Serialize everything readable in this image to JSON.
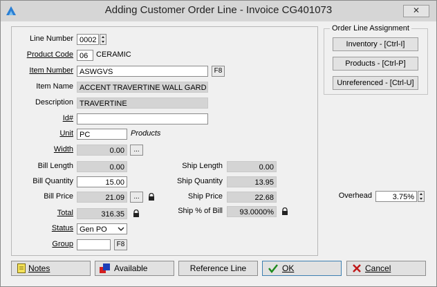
{
  "window": {
    "title": "Adding Customer Order Line - Invoice CG401073",
    "close_label": "✕"
  },
  "form": {
    "line_number": {
      "label": "Line Number",
      "value": "0002"
    },
    "product_code": {
      "label": "Product Code",
      "value": "06",
      "description": "CERAMIC"
    },
    "item_number": {
      "label": "Item Number",
      "value": "ASWGVS",
      "lookup": "F8"
    },
    "item_name": {
      "label": "Item Name",
      "value": "ACCENT TRAVERTINE WALL GARD"
    },
    "description": {
      "label": "Description",
      "value": "TRAVERTINE"
    },
    "id": {
      "label": "Id#",
      "value": ""
    },
    "unit": {
      "label": "Unit",
      "value": "PC",
      "note": "Products"
    },
    "width": {
      "label": "Width",
      "value": "0.00",
      "button": "..."
    },
    "bill_length": {
      "label": "Bill Length",
      "value": "0.00"
    },
    "bill_quantity": {
      "label": "Bill Quantity",
      "value": "15.00"
    },
    "bill_price": {
      "label": "Bill Price",
      "value": "21.09",
      "button": "..."
    },
    "total": {
      "label": "Total",
      "value": "316.35"
    },
    "status": {
      "label": "Status",
      "value": "Gen PO"
    },
    "group": {
      "label": "Group",
      "value": "",
      "lookup": "F8"
    },
    "ship_length": {
      "label": "Ship Length",
      "value": "0.00"
    },
    "ship_quantity": {
      "label": "Ship Quantity",
      "value": "13.95"
    },
    "ship_price": {
      "label": "Ship Price",
      "value": "22.68"
    },
    "ship_pct_bill": {
      "label": "Ship % of Bill",
      "value": "93.0000%"
    }
  },
  "assignment": {
    "title": "Order Line Assignment",
    "inventory": "Inventory - [Ctrl-I]",
    "products": "Products - [Ctrl-P]",
    "unreferenced": "Unreferenced - [Ctrl-U]"
  },
  "overhead": {
    "label": "Overhead",
    "value": "3.75%"
  },
  "footer": {
    "notes": "Notes",
    "available": "Available",
    "reference_line": "Reference Line",
    "ok": "OK",
    "cancel": "Cancel"
  }
}
